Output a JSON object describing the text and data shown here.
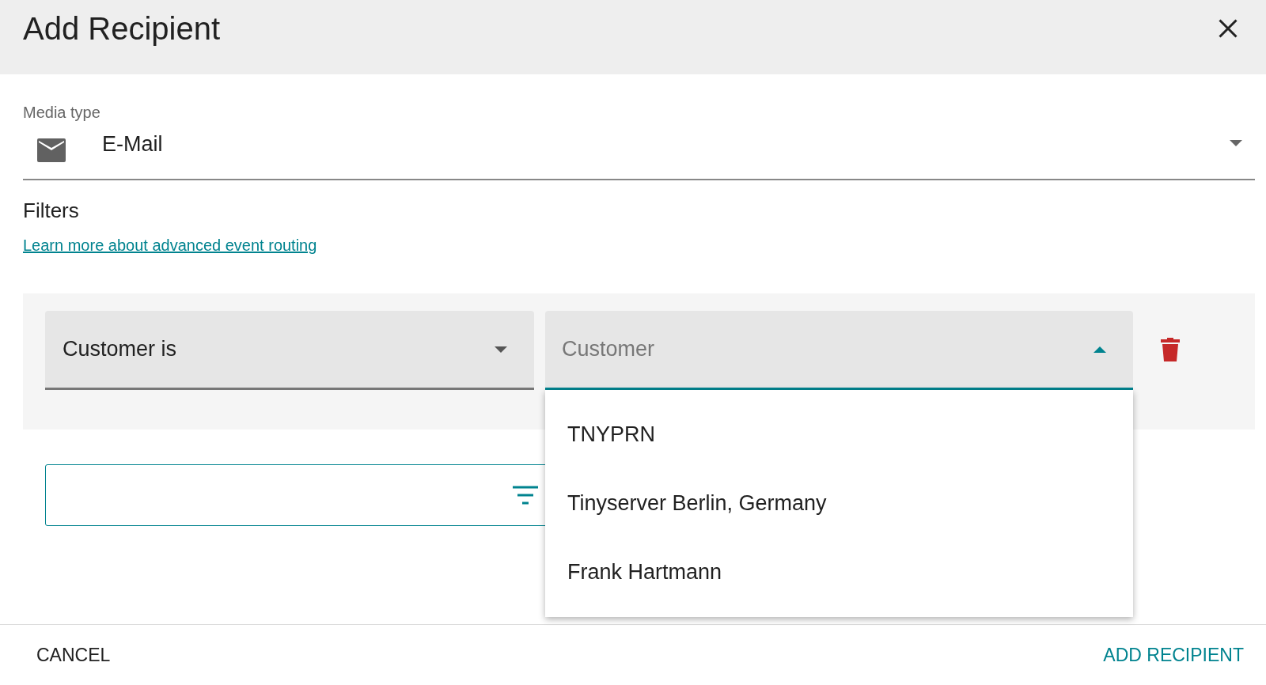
{
  "dialog": {
    "title": "Add Recipient"
  },
  "media_type": {
    "label": "Media type",
    "value": "E-Mail"
  },
  "filters": {
    "heading": "Filters",
    "link": "Learn more about advanced event routing"
  },
  "filter_rows": [
    {
      "condition": "Customer is",
      "value_placeholder": "Customer",
      "expanded": true,
      "options": [
        {
          "label": "TNYPRN"
        },
        {
          "label": "Tinyserver Berlin, Germany"
        },
        {
          "label": "Frank Hartmann"
        }
      ]
    }
  ],
  "buttons": [
    {
      "label": "CANCEL",
      "kind": "secondary"
    },
    {
      "label": "ADD RECIPIENT",
      "kind": "primary"
    }
  ]
}
